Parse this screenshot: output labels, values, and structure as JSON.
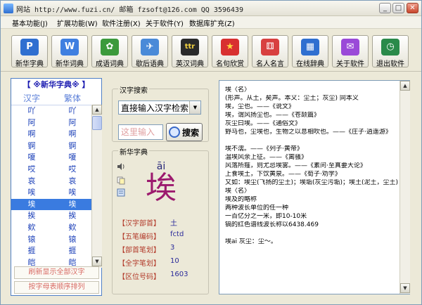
{
  "window": {
    "title": "网站 http://www.fuzi.cn/  邮箱 fzsoft@126.com  QQ 3596439",
    "minimize_glyph": "_",
    "maximize_glyph": "□",
    "close_glyph": "✕"
  },
  "menu": [
    {
      "label": "基本功能(J)"
    },
    {
      "label": "扩展功能(W)"
    },
    {
      "label": "软件注册(X)"
    },
    {
      "label": "关于软件(Y)"
    },
    {
      "label": "数据库扩充(Z)"
    }
  ],
  "toolbar": [
    {
      "label": "新华字典",
      "icon": "P",
      "icon_name": "xinhua-dict-icon",
      "color": "#2f6fd0"
    },
    {
      "label": "新华词典",
      "icon": "W",
      "icon_name": "xinhua-word-icon",
      "color": "#3f7fe0"
    },
    {
      "label": "成语词典",
      "icon": "✿",
      "icon_name": "idiom-dict-icon",
      "color": "#3c9a3c"
    },
    {
      "label": "歇后语典",
      "icon": "✈",
      "icon_name": "xiehouyu-icon",
      "color": "#4a8ad8"
    },
    {
      "label": "英汉词典",
      "icon": "ttr",
      "icon_name": "en-cn-dict-icon",
      "color": "#2a2a2a"
    },
    {
      "label": "名句欣赏",
      "icon": "★",
      "icon_name": "quote-star-icon",
      "color": "#d83030"
    },
    {
      "label": "名人名言",
      "icon": "⚅",
      "icon_name": "famous-saying-icon",
      "color": "#d84040"
    },
    {
      "label": "在线辞典",
      "icon": "▦",
      "icon_name": "online-dict-icon",
      "color": "#2f6fd0"
    },
    {
      "label": "关于软件",
      "icon": "✉",
      "icon_name": "about-icon",
      "color": "#9a4ad8"
    },
    {
      "label": "退出软件",
      "icon": "◷",
      "icon_name": "exit-icon",
      "color": "#2a8a4a"
    }
  ],
  "left_panel": {
    "header": "【 ※新华字典※ 】",
    "col_simplified": "汉字",
    "col_traditional": "繁体",
    "rows": [
      {
        "s": "吖",
        "t": "吖"
      },
      {
        "s": "阿",
        "t": "阿"
      },
      {
        "s": "啊",
        "t": "啊"
      },
      {
        "s": "锕",
        "t": "锕"
      },
      {
        "s": "嗄",
        "t": "嗄"
      },
      {
        "s": "哎",
        "t": "哎"
      },
      {
        "s": "哀",
        "t": "哀"
      },
      {
        "s": "唉",
        "t": "唉"
      },
      {
        "s": "埃",
        "t": "埃"
      },
      {
        "s": "挨",
        "t": "挨"
      },
      {
        "s": "欸",
        "t": "欸"
      },
      {
        "s": "锿",
        "t": "锿"
      },
      {
        "s": "捱",
        "t": "捱"
      },
      {
        "s": "皑",
        "t": "皑"
      }
    ],
    "selected_index": 8,
    "btn_refresh": "刷新显示全部汉字",
    "btn_sort": "按字母表顺序排列"
  },
  "search": {
    "group_title": "汉字搜索",
    "combo_value": "直接输入汉字检索",
    "input_placeholder": "这里输入",
    "search_label": "搜索"
  },
  "card": {
    "group_title": "新华字典",
    "pinyin": "āi",
    "character": "埃",
    "fields": [
      {
        "label": "【汉字部首】",
        "value": "土"
      },
      {
        "label": "【五笔编码】",
        "value": "fctd"
      },
      {
        "label": "【部首笔划】",
        "value": "3"
      },
      {
        "label": "【全字笔划】",
        "value": "10"
      },
      {
        "label": "【区位号码】",
        "value": "1603"
      }
    ]
  },
  "definition": {
    "lines": [
      "埃〈名〉",
      "(形声。从土，矣声。本义：尘土；灰尘) 同本义",
      "埃，尘也。——《说文》",
      "埃，谓风扬尘也。——《苍颉篇》",
      "灰尘曰埃。——《通俗文》",
      "野马也，尘埃也，生物之以息相吹也。——《庄子·逍遥游》",
      "",
      "埃不濡。——《列子·黄帝》",
      "温埃风余上征。——《离骚》",
      "风落所薤，则尤忌埃雾。——《素问·至真要大论》",
      "上食埃土，下饮黄泉。——《荀子·劝学》",
      "又如：埃尘(飞扬的尘土)；埃垢(灰尘污垢)；埃土(泥土，尘土)",
      "埃〈名〉",
      "埃及的略称",
      "两种波长单位的任一种",
      "一百亿分之一米，即10-10米",
      "镉的红色谱线波长称以6438.469",
      "",
      "埃ai  灰尘：尘～。"
    ]
  }
}
